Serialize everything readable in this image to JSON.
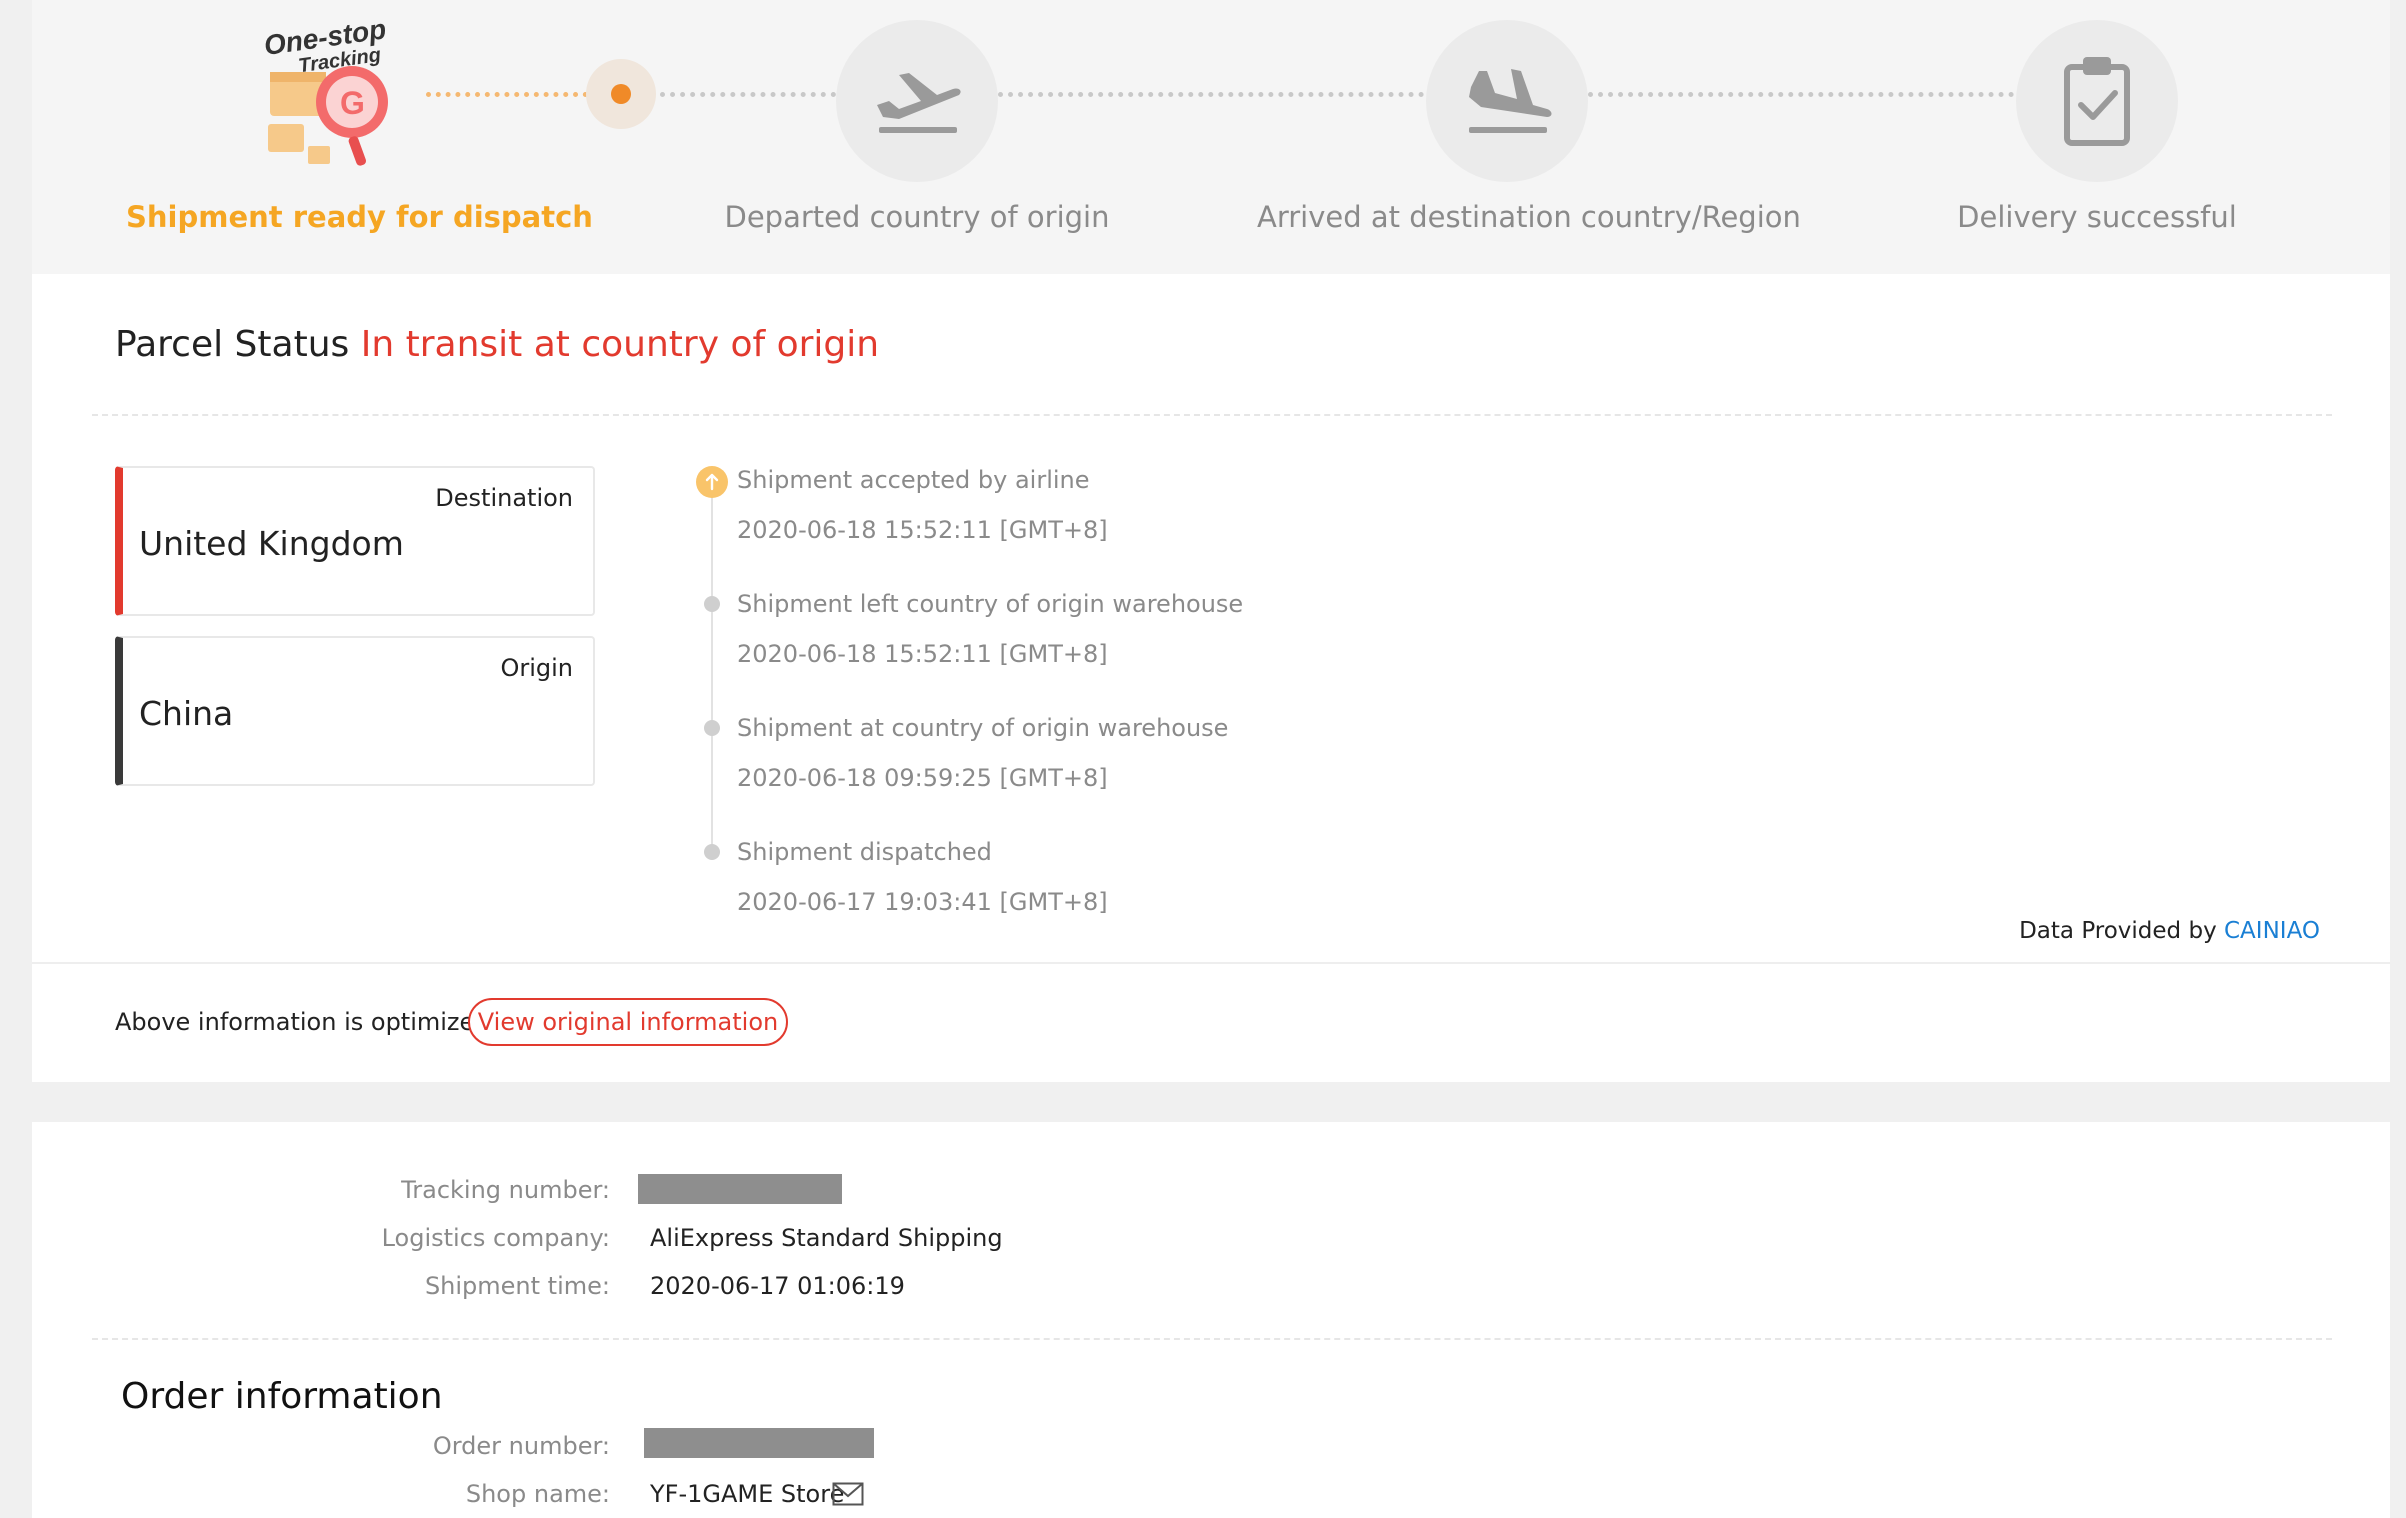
{
  "progress": {
    "logo_line1": "One-stop",
    "logo_line2": "Tracking",
    "steps": [
      {
        "label": "Shipment ready for dispatch",
        "icon": "tracking-logo",
        "active": true
      },
      {
        "label": "Departed country of origin",
        "icon": "plane-takeoff-icon",
        "active": false
      },
      {
        "label": "Arrived at destination country/Region",
        "icon": "plane-landing-icon",
        "active": false
      },
      {
        "label": "Delivery successful",
        "icon": "clipboard-check-icon",
        "active": false
      }
    ],
    "active_color": "#f5a623"
  },
  "status": {
    "prefix": "Parcel Status",
    "value": "In transit at country of origin",
    "value_color": "#e23a2e"
  },
  "locations": {
    "destination": {
      "tag": "Destination",
      "name": "United Kingdom"
    },
    "origin": {
      "tag": "Origin",
      "name": "China"
    }
  },
  "timeline": [
    {
      "title": "Shipment accepted by airline",
      "time": "2020-06-18 15:52:11 [GMT+8]"
    },
    {
      "title": "Shipment left country of origin warehouse",
      "time": "2020-06-18 15:52:11 [GMT+8]"
    },
    {
      "title": "Shipment at country of origin warehouse",
      "time": "2020-06-18 09:59:25 [GMT+8]"
    },
    {
      "title": "Shipment dispatched",
      "time": "2020-06-17 19:03:41 [GMT+8]"
    }
  ],
  "provider": {
    "prefix": "Data Provided by",
    "name": "CAINIAO"
  },
  "optimized": {
    "text": "Above information is optimized",
    "button": "View original information"
  },
  "shipment": {
    "tracking_label": "Tracking number:",
    "logistics_label": "Logistics company:",
    "logistics_value": "AliExpress Standard Shipping",
    "time_label": "Shipment time:",
    "time_value": "2020-06-17 01:06:19"
  },
  "order": {
    "heading": "Order information",
    "number_label": "Order number:",
    "shop_label": "Shop name:",
    "shop_value": "YF-1GAME Store"
  }
}
